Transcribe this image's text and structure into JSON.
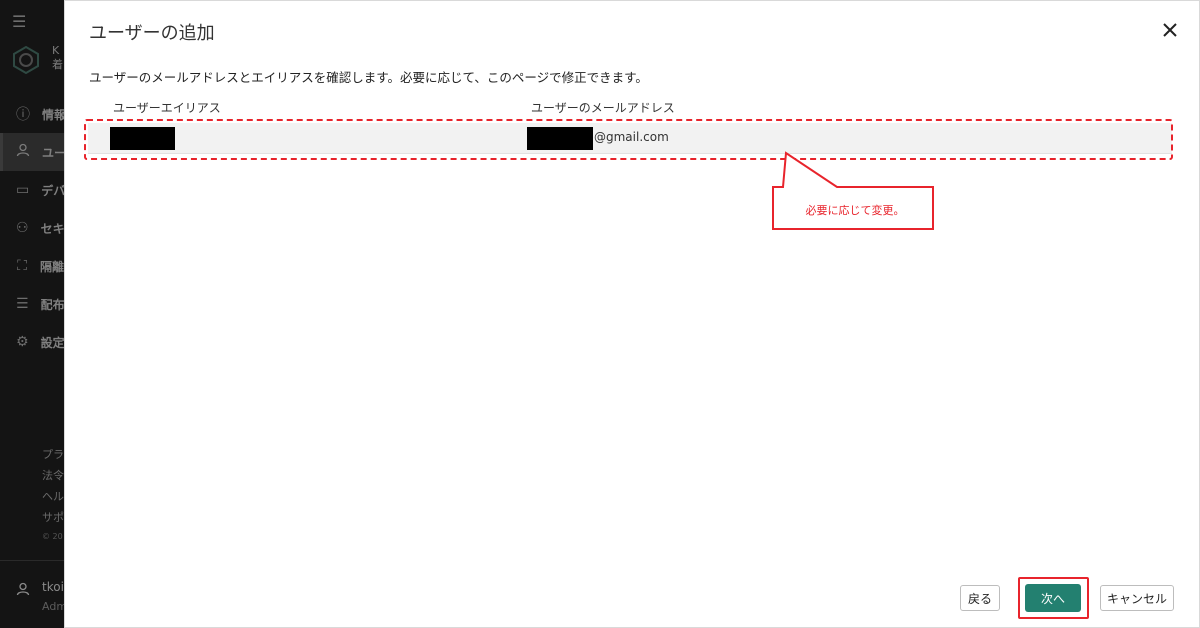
{
  "background_sidebar": {
    "brand_lines": [
      "K",
      "着"
    ],
    "nav_items": [
      {
        "icon": "info-icon",
        "label": "情報",
        "active": false
      },
      {
        "icon": "user-icon",
        "label": "ユー",
        "active": true
      },
      {
        "icon": "device-icon",
        "label": "デバ",
        "active": false
      },
      {
        "icon": "security-icon",
        "label": "セキ",
        "active": false
      },
      {
        "icon": "quarantine-icon",
        "label": "隔離",
        "active": false
      },
      {
        "icon": "distribution-icon",
        "label": "配布",
        "active": false
      },
      {
        "icon": "gear-icon",
        "label": "設定",
        "active": false
      }
    ],
    "footer_links": [
      "プラ",
      "法令",
      "ヘル",
      "サポ"
    ],
    "copyright": "© 20",
    "user_name": "tkoi",
    "user_role": "Adm"
  },
  "dialog": {
    "title": "ユーザーの追加",
    "description": "ユーザーのメールアドレスとエイリアスを確認します。必要に応じて、このページで修正できます。",
    "columns": {
      "alias": "ユーザーエイリアス",
      "email": "ユーザーのメールアドレス"
    },
    "rows": [
      {
        "alias": "",
        "email_suffix": "@gmail.com"
      }
    ],
    "buttons": {
      "back": "戻る",
      "next": "次へ",
      "cancel": "キャンセル"
    }
  },
  "annotation": {
    "callout_text": "必要に応じて変更。",
    "color": "#e8242c"
  },
  "colors": {
    "accent": "#238070",
    "annotation_red": "#e8242c"
  }
}
